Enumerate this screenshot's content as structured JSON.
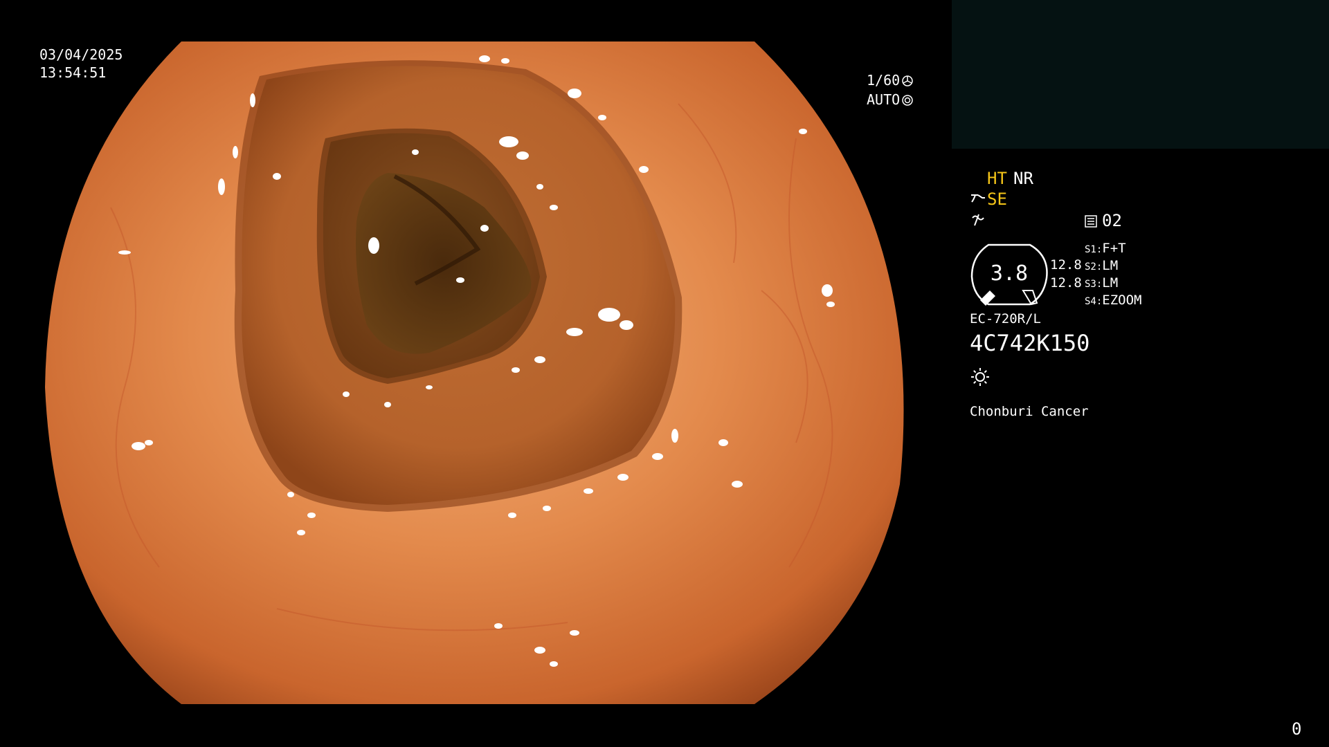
{
  "overlay": {
    "date": "03/04/2025",
    "time": "13:54:51",
    "shutter": "1/60",
    "iris": "AUTO",
    "counter": "0"
  },
  "panel": {
    "mode_ht": "HT",
    "mode_nr": "NR",
    "mode_se": "SE",
    "preset": "02",
    "gauge_value": "3.8",
    "zoom_line_1": "12.8",
    "zoom_line_2": "12.8",
    "switches": [
      {
        "key": "S1:",
        "value": "F+T"
      },
      {
        "key": "S2:",
        "value": "LM"
      },
      {
        "key": "S3:",
        "value": "LM"
      },
      {
        "key": "S4:",
        "value": "EZOOM"
      }
    ],
    "scope_model": "EC-720R/L",
    "scope_serial": "4C742K150",
    "hospital": "Chonburi Cancer"
  },
  "colors": {
    "background": "#000000",
    "text": "#ffffff",
    "accent": "#f5c518",
    "thumbnail_bg": "#051212",
    "mucosa_light": "#f0a466",
    "mucosa_mid": "#d77a3e",
    "mucosa_dark": "#7a3a16",
    "lumen_dark": "#3a1e08"
  },
  "icons": [
    "shutter-icon",
    "iris-icon",
    "scope-angle-icon",
    "structure-enhance-icon",
    "preset-icon",
    "light-icon"
  ]
}
